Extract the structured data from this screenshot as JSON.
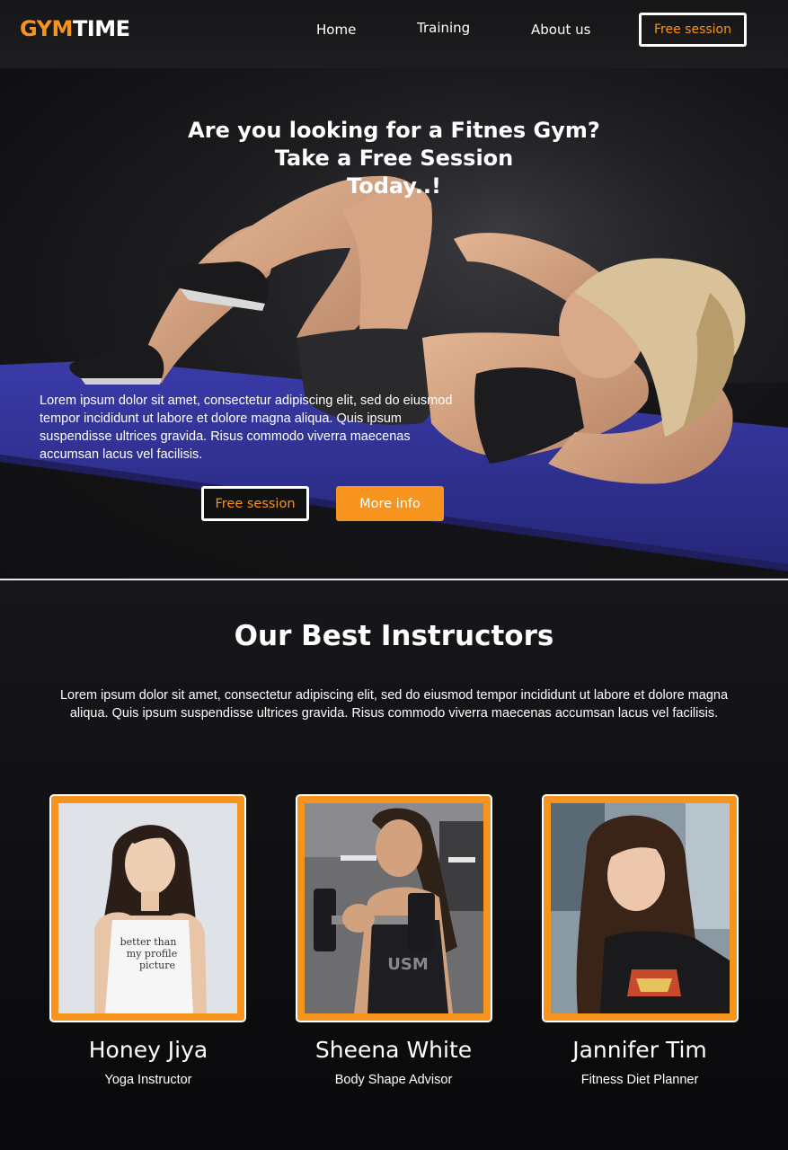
{
  "nav": {
    "logo_part1": "GYM",
    "logo_part2": "TIME",
    "links": [
      "Home",
      "Training",
      "About us"
    ],
    "cta": "Free session"
  },
  "hero": {
    "title_line1": "Are you looking for a Fitnes Gym?",
    "title_line2": "Take a Free Session",
    "title_line3": "Today..!",
    "text": "Lorem ipsum dolor sit amet, consectetur adipiscing elit, sed do eiusmod tempor incididunt ut labore et dolore magna aliqua. Quis ipsum suspendisse ultrices gravida. Risus commodo viverra maecenas accumsan lacus vel facilisis.",
    "btn_primary": "Free session",
    "btn_secondary": "More info"
  },
  "instructors": {
    "title": "Our Best Instructors",
    "text": "Lorem ipsum dolor sit amet, consectetur adipiscing elit, sed do eiusmod tempor incididunt ut labore et dolore magna aliqua. Quis ipsum suspendisse ultrices gravida. Risus commodo viverra maecenas accumsan lacus vel facilisis.",
    "cards": [
      {
        "name": "Honey Jiya",
        "role": "Yoga Instructor",
        "shirt_text": "better than my profile picture"
      },
      {
        "name": "Sheena White",
        "role": "Body Shape Advisor",
        "shirt_text": "USM"
      },
      {
        "name": "Jannifer Tim",
        "role": "Fitness Diet Planner"
      }
    ]
  },
  "colors": {
    "accent": "#f7941d",
    "background": "#0b0b0e",
    "mat": "#33349a"
  }
}
